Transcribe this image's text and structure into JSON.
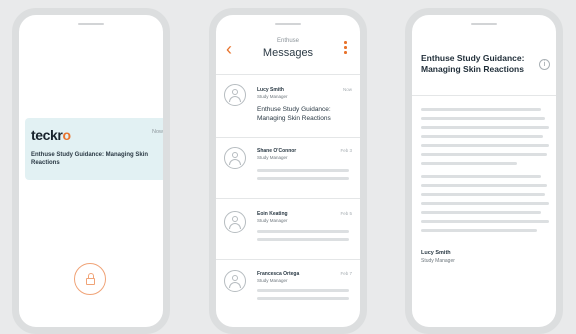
{
  "lock_screen": {
    "notification": {
      "app_name": "teckro",
      "time": "Now",
      "text": "Enthuse Study Guidance: Managing Skin Reactions"
    },
    "unlock_icon": "lock-icon"
  },
  "messages_screen": {
    "header": {
      "supertitle": "Enthuse",
      "title": "Messages",
      "back_icon": "chevron-left-icon",
      "menu_icon": "kebab-menu-icon"
    },
    "items": [
      {
        "name": "Lucy Smith",
        "role": "Study Manager",
        "time": "Now",
        "preview": "Enthuse Study Guidance: Managing Skin Reactions"
      },
      {
        "name": "Shane O'Connor",
        "role": "Study Manager",
        "time": "Feb 3",
        "preview": ""
      },
      {
        "name": "Eoin Keating",
        "role": "Study Manager",
        "time": "Feb 5",
        "preview": ""
      },
      {
        "name": "Francesca Ortega",
        "role": "Study Manager",
        "time": "Feb 7",
        "preview": ""
      }
    ]
  },
  "detail_screen": {
    "title": "Enthuse Study Guidance: Managing Skin Reactions",
    "info_icon": "info-icon",
    "sender": {
      "name": "Lucy Smith",
      "role": "Study Manager"
    }
  },
  "colors": {
    "accent": "#e8732c",
    "notification_bg": "#e2f1f3",
    "text_dark": "#2b3a45",
    "placeholder": "#dcdfe1"
  }
}
